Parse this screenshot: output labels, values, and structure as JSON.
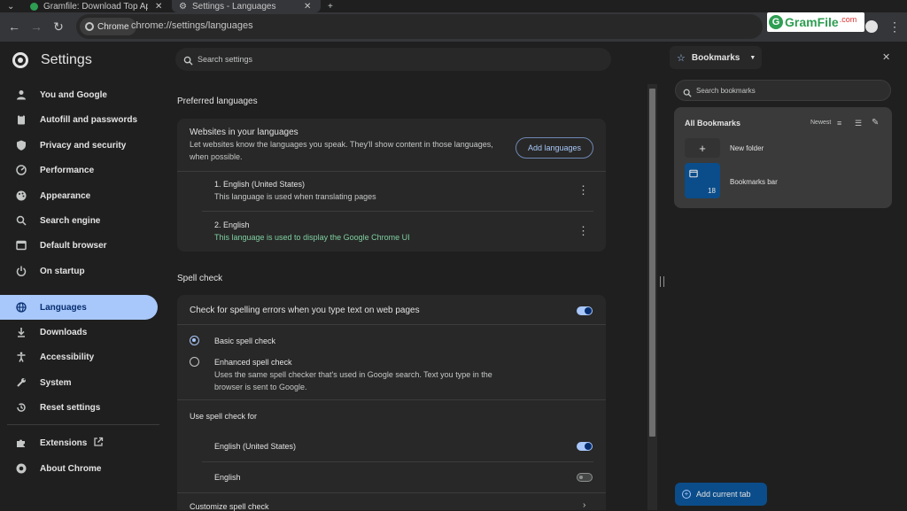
{
  "tabs": [
    {
      "label": "Gramfile: Download Top App"
    },
    {
      "label": "Settings - Languages"
    }
  ],
  "toolbar": {
    "chip_label": "Chrome",
    "url": "chrome://settings/languages"
  },
  "watermark": {
    "text": "GramFile",
    "suffix": ".com"
  },
  "settings": {
    "title": "Settings",
    "search_placeholder": "Search settings"
  },
  "sidebar": {
    "items": [
      {
        "label": "You and Google",
        "icon": "person-icon"
      },
      {
        "label": "Autofill and passwords",
        "icon": "clipboard-icon"
      },
      {
        "label": "Privacy and security",
        "icon": "shield-icon"
      },
      {
        "label": "Performance",
        "icon": "speedometer-icon"
      },
      {
        "label": "Appearance",
        "icon": "palette-icon"
      },
      {
        "label": "Search engine",
        "icon": "search-icon"
      },
      {
        "label": "Default browser",
        "icon": "browser-icon"
      },
      {
        "label": "On startup",
        "icon": "power-icon"
      },
      {
        "label": "Languages",
        "icon": "globe-icon",
        "active": true
      },
      {
        "label": "Downloads",
        "icon": "download-icon"
      },
      {
        "label": "Accessibility",
        "icon": "accessibility-icon"
      },
      {
        "label": "System",
        "icon": "wrench-icon"
      },
      {
        "label": "Reset settings",
        "icon": "history-icon"
      },
      {
        "label": "Extensions",
        "icon": "puzzle-icon"
      },
      {
        "label": "About Chrome",
        "icon": "chrome-icon"
      }
    ]
  },
  "preferred": {
    "heading": "Preferred languages",
    "card_title": "Websites in your languages",
    "card_desc_line1": "Let websites know the languages you speak. They'll show content in those languages,",
    "card_desc_line2": "when possible.",
    "add_button": "Add languages",
    "languages": [
      {
        "name": "1. English (United States)",
        "note": "This language is used when translating pages"
      },
      {
        "name": "2. English",
        "note": "This language is used to display the Google Chrome UI"
      }
    ]
  },
  "spell": {
    "heading": "Spell check",
    "check_label": "Check for spelling errors when you type text on web pages",
    "check_on": true,
    "basic_label": "Basic spell check",
    "enhanced_label": "Enhanced spell check",
    "enhanced_desc_line1": "Uses the same spell checker that's used in Google search. Text you type in the",
    "enhanced_desc_line2": "browser is sent to Google.",
    "selected_mode": "basic",
    "use_for_heading": "Use spell check for",
    "use_for": [
      {
        "label": "English (United States)",
        "on": true
      },
      {
        "label": "English",
        "on": false
      }
    ],
    "customize_label": "Customize spell check"
  },
  "bookmarks": {
    "dropdown_label": "Bookmarks",
    "search_placeholder": "Search bookmarks",
    "section_title": "All Bookmarks",
    "sort_label": "Newest",
    "new_folder_label": "New folder",
    "bar_label": "Bookmarks bar",
    "bar_count": "18",
    "add_current_tab": "Add current tab"
  },
  "colors": {
    "accent": "#a8c7fa",
    "accent_dark": "#062e6f",
    "background": "#1f1f1f",
    "card": "#282828",
    "green_text": "#7fcfa0"
  }
}
